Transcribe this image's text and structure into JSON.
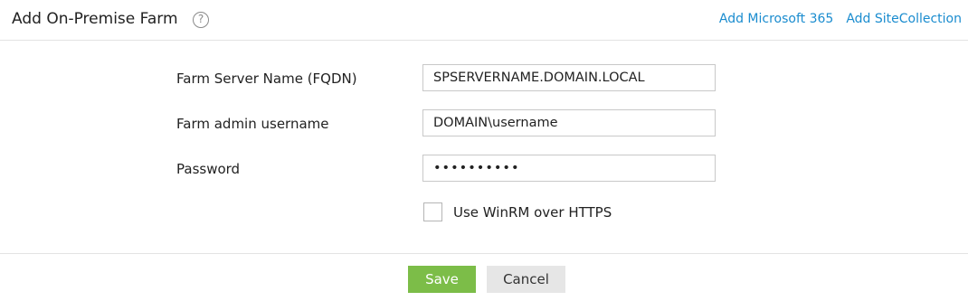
{
  "header": {
    "title": "Add On-Premise Farm",
    "help_icon": "?",
    "links": {
      "add_m365": "Add Microsoft 365",
      "add_site_collection": "Add SiteCollection"
    }
  },
  "form": {
    "server_name": {
      "label": "Farm Server Name (FQDN)",
      "value": "SPSERVERNAME.DOMAIN.LOCAL"
    },
    "admin_username": {
      "label": "Farm admin username",
      "value": "DOMAIN\\username"
    },
    "password": {
      "label": "Password",
      "value": "••••••••••"
    },
    "winrm": {
      "label": "Use WinRM over HTTPS",
      "checked": false
    }
  },
  "footer": {
    "save_label": "Save",
    "cancel_label": "Cancel"
  },
  "colors": {
    "accent_link": "#1a8ccf",
    "save_button": "#7cbd48",
    "cancel_button": "#e6e6e6"
  }
}
